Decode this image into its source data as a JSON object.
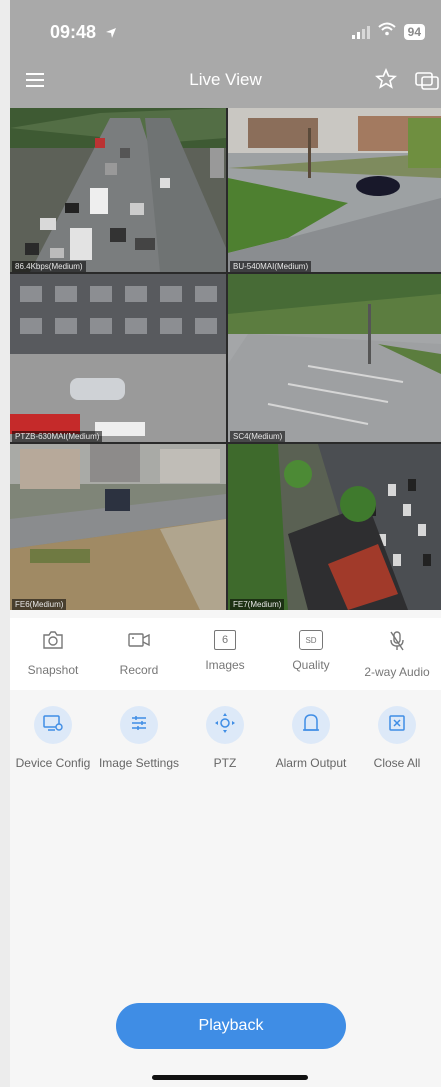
{
  "status_bar": {
    "time": "09:48",
    "battery": "94"
  },
  "nav": {
    "title": "Live View"
  },
  "cameras": [
    {
      "label": "86.4Kbps(Medium)"
    },
    {
      "label": "BU-540MAI(Medium)"
    },
    {
      "label": "PTZB-630MAI(Medium)"
    },
    {
      "label": "SC4(Medium)"
    },
    {
      "label": "FE6(Medium)"
    },
    {
      "label": "FE7(Medium)"
    }
  ],
  "toolbar": [
    {
      "label": "Snapshot",
      "icon": "camera-icon"
    },
    {
      "label": "Record",
      "icon": "video-record-icon"
    },
    {
      "label": "Images",
      "icon": "images-count-icon",
      "badge": "6"
    },
    {
      "label": "Quality",
      "icon": "quality-icon",
      "badge": "SD"
    },
    {
      "label": "2-way Audio",
      "icon": "microphone-icon"
    }
  ],
  "actions": [
    {
      "label": "Device Config",
      "icon": "device-config-icon"
    },
    {
      "label": "Image Settings",
      "icon": "sliders-icon"
    },
    {
      "label": "PTZ",
      "icon": "ptz-icon"
    },
    {
      "label": "Alarm Output",
      "icon": "alarm-icon"
    },
    {
      "label": "Close All",
      "icon": "close-all-icon"
    }
  ],
  "playback": {
    "label": "Playback"
  },
  "colors": {
    "header": "#a9a9a9",
    "accent": "#3f8de5",
    "action_bg": "#dde9f8"
  }
}
